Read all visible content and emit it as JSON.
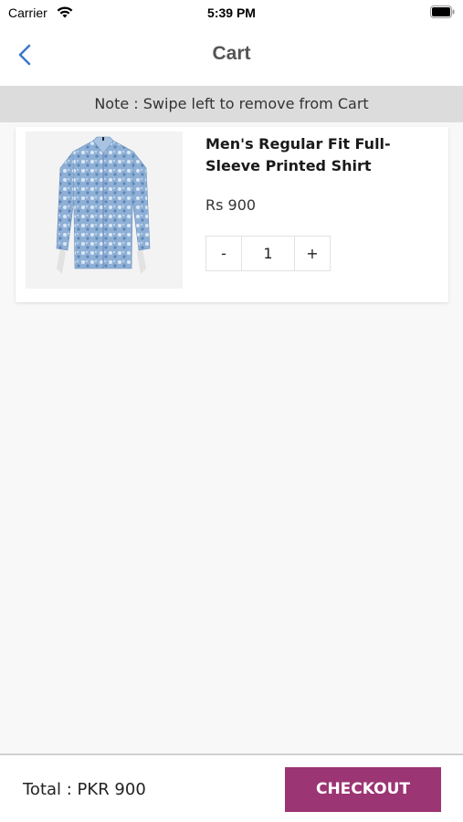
{
  "status_bar": {
    "carrier": "Carrier",
    "time": "5:39 PM",
    "wifi_icon": "wifi-icon",
    "battery_icon": "battery-icon"
  },
  "nav": {
    "title": "Cart",
    "back_icon": "chevron-left-icon",
    "accent_color": "#3f78c8"
  },
  "note": {
    "text": "Note : Swipe left to remove from Cart"
  },
  "cart": {
    "items": [
      {
        "name": "Men's Regular Fit Full-Sleeve Printed Shirt",
        "price": "Rs 900",
        "quantity": "1",
        "decrement_label": "-",
        "increment_label": "+",
        "image_icon": "shirt-image"
      }
    ]
  },
  "footer": {
    "total": "Total : PKR 900",
    "checkout_label": "CHECKOUT",
    "checkout_color": "#9b3573"
  }
}
